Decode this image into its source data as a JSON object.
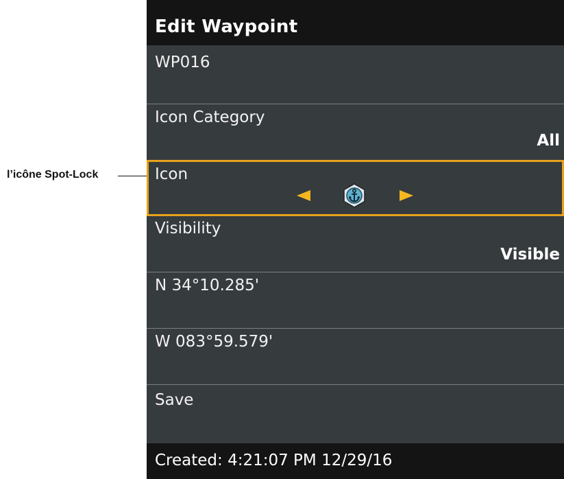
{
  "callout": {
    "label": "l’icône Spot-Lock"
  },
  "dialog": {
    "title": "Edit Waypoint",
    "name": "WP016",
    "icon_category": {
      "label": "Icon Category",
      "value": "All"
    },
    "icon": {
      "label": "Icon",
      "selected_icon": "anchor-icon"
    },
    "visibility": {
      "label": "Visibility",
      "value": "Visible"
    },
    "latitude": "N 34°10.285'",
    "longitude": "W 083°59.579'",
    "save_label": "Save",
    "footer": "Created: 4:21:07 PM 12/29/16"
  },
  "colors": {
    "panel_bg": "#363b3e",
    "bar_bg": "#141414",
    "accent": "#e8a21c",
    "arrow": "#f4b71f"
  }
}
